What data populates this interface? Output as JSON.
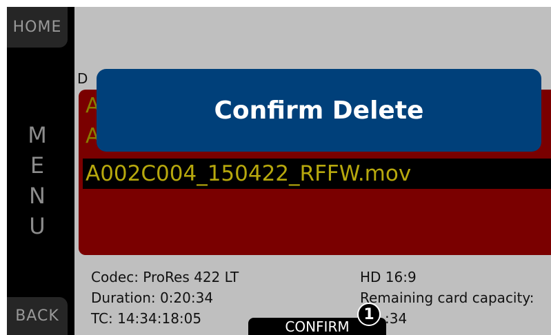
{
  "sidebar": {
    "home_label": "HOME",
    "menu_letters": [
      "M",
      "E",
      "N",
      "U"
    ],
    "back_label": "BACK"
  },
  "section": {
    "label": "D"
  },
  "files": {
    "partial_rows": [
      "A",
      "A"
    ],
    "selected": "A002C004_150422_RFFW.mov"
  },
  "dialog": {
    "title": "Confirm Delete"
  },
  "info": {
    "codec": "Codec: ProRes 422 LT",
    "duration": "Duration: 0:20:34",
    "tc": "TC: 14:34:18:05",
    "format": "HD 16:9",
    "remaining": "Remaining card capacity:",
    "remaining_value": ":34"
  },
  "footer": {
    "confirm_label": "CONFIRM",
    "badge": "1"
  },
  "colors": {
    "panel_red": "#7a0000",
    "dialog_blue": "#00407a",
    "selected_text": "#b7a80d"
  }
}
